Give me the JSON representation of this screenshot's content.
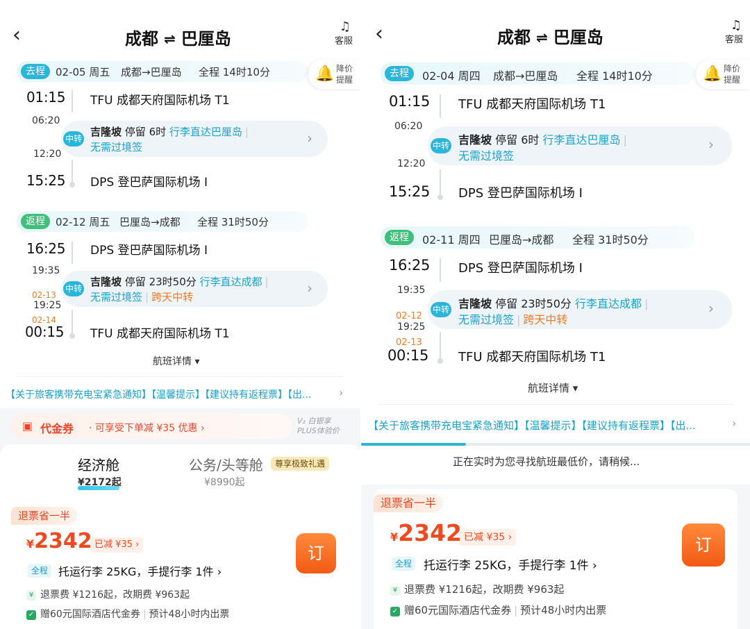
{
  "common": {
    "back_icon": "chevron-left-icon",
    "origin": "成都",
    "destination": "巴厘岛",
    "swap_icon": "⇌",
    "customer_service": "客服",
    "price_alert": [
      "降价",
      "提醒"
    ],
    "flight_details": "航班详情",
    "notice": "【关于旅客携带充电宝紧急通知】【温馨提示】【建议持有返程票】【出...",
    "colors": {
      "accent": "#2bb6d9",
      "orange": "#f25a16",
      "price": "#ee4a1f",
      "green": "#2aa862"
    }
  },
  "left": {
    "outbound": {
      "tag": "去程",
      "date": "02-05 周五",
      "route": "成都→巴厘岛",
      "duration": "全程 14时10分",
      "dep_time": "01:15",
      "dep_airport": "TFU 成都天府国际机场 T1",
      "transfer_arrive": "06:20",
      "transfer_depart": "12:20",
      "transfer_badge": "中转",
      "transfer_city": "吉隆坡",
      "transfer_stay": "停留 6时",
      "transfer_baggage": "行李直达巴厘岛",
      "transfer_visa": "无需过境签",
      "arr_time": "15:25",
      "arr_airport": "DPS 登巴萨国际机场 I"
    },
    "return": {
      "tag": "返程",
      "date": "02-12 周五",
      "route": "巴厘岛→成都",
      "duration": "全程 31时50分",
      "dep_time": "16:25",
      "dep_airport": "DPS 登巴萨国际机场 I",
      "transfer_arrive": "19:35",
      "transfer_depart_date": "02-13",
      "transfer_depart": "19:25",
      "transfer_badge": "中转",
      "transfer_city": "吉隆坡",
      "transfer_stay": "停留 23时50分",
      "transfer_baggage": "行李直达成都",
      "transfer_visa": "无需过境签",
      "transfer_overnight": "跨天中转",
      "arr_date": "02-14",
      "arr_time": "00:15",
      "arr_airport": "TFU 成都天府国际机场 T1"
    },
    "coupon": {
      "title": "代金券",
      "desc": "· 可享受下单减 ¥35 优惠 ›",
      "vip_l1": "V₂ 白银享",
      "vip_l2": "PLUS体验价"
    },
    "cabins": [
      {
        "name": "经济舱",
        "price": "¥2172起"
      },
      {
        "name": "公务/头等舱",
        "price": "¥8990起",
        "tag": "尊享极致礼遇"
      }
    ],
    "fare": {
      "refund_tag": "退票省一半",
      "currency": "¥",
      "price": "2342",
      "discount": "已减 ¥35 ›",
      "book": "订",
      "full_tag": "全程",
      "baggage": "托运行李 25KG，手提行李 1件 ›",
      "fees": "退票费 ¥1216起，改期费 ¥963起",
      "gift": "赠60元国际酒店代金券",
      "ticketing": "预计48小时内出票"
    }
  },
  "right": {
    "outbound": {
      "tag": "去程",
      "date": "02-04 周四",
      "route": "成都→巴厘岛",
      "duration": "全程 14时10分",
      "dep_time": "01:15",
      "dep_airport": "TFU 成都天府国际机场 T1",
      "transfer_arrive": "06:20",
      "transfer_depart": "12:20",
      "transfer_badge": "中转",
      "transfer_city": "吉隆坡",
      "transfer_stay": "停留 6时",
      "transfer_baggage": "行李直达巴厘岛",
      "transfer_visa": "无需过境签",
      "arr_time": "15:25",
      "arr_airport": "DPS 登巴萨国际机场 I"
    },
    "return": {
      "tag": "返程",
      "date": "02-11 周四",
      "route": "巴厘岛→成都",
      "duration": "全程 31时50分",
      "dep_time": "16:25",
      "dep_airport": "DPS 登巴萨国际机场 I",
      "transfer_arrive": "19:35",
      "transfer_depart_date": "02-12",
      "transfer_depart": "19:25",
      "transfer_badge": "中转",
      "transfer_city": "吉隆坡",
      "transfer_stay": "停留 23时50分",
      "transfer_baggage": "行李直达成都",
      "transfer_visa": "无需过境签",
      "transfer_overnight": "跨天中转",
      "arr_date": "02-13",
      "arr_time": "00:15",
      "arr_airport": "TFU 成都天府国际机场 T1"
    },
    "loading": "正在实时为您寻找航班最低价，请稍候...",
    "progress_fraction": 0.27,
    "fare": {
      "refund_tag": "退票省一半",
      "currency": "¥",
      "price": "2342",
      "discount": "已减 ¥35 ›",
      "book": "订",
      "full_tag": "全程",
      "baggage": "托运行李 25KG，手提行李 1件 ›",
      "fees": "退票费 ¥1216起，改期费 ¥963起",
      "gift": "赠60元国际酒店代金券",
      "ticketing": "预计48小时内出票"
    }
  }
}
